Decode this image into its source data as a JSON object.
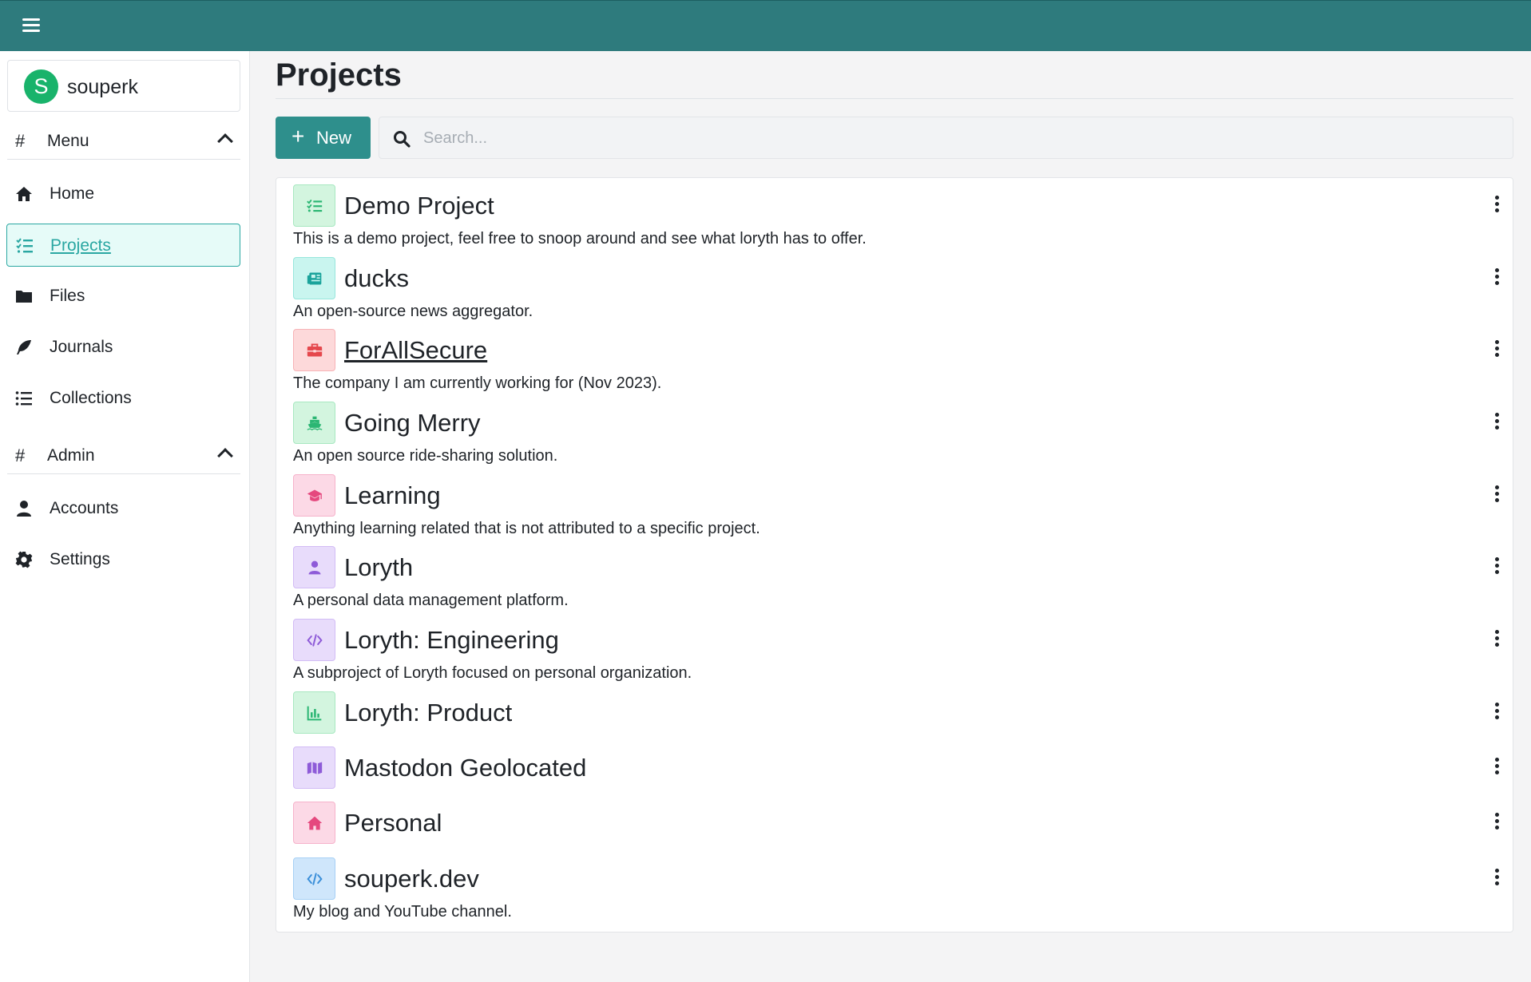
{
  "sidebar": {
    "user": {
      "initial": "S",
      "name": "souperk"
    },
    "sections": [
      {
        "label": "Menu",
        "hash": "#"
      },
      {
        "label": "Admin",
        "hash": "#"
      }
    ],
    "menu_items": [
      {
        "label": "Home",
        "icon": "home-icon"
      },
      {
        "label": "Projects",
        "icon": "checklist-icon",
        "active": true
      },
      {
        "label": "Files",
        "icon": "folder-icon"
      },
      {
        "label": "Journals",
        "icon": "feather-icon"
      },
      {
        "label": "Collections",
        "icon": "list-icon"
      }
    ],
    "admin_items": [
      {
        "label": "Accounts",
        "icon": "user-icon"
      },
      {
        "label": "Settings",
        "icon": "gear-icon"
      }
    ]
  },
  "main": {
    "title": "Projects",
    "new_button": "New",
    "search_placeholder": "Search...",
    "projects": [
      {
        "name": "Demo Project",
        "description": "This is a demo project, feel free to snoop around and see what loryth has to offer.",
        "icon": "checklist-icon",
        "color": "#2bb673"
      },
      {
        "name": "ducks",
        "description": "An open-source news aggregator.",
        "icon": "newspaper-icon",
        "color": "#1aa39b"
      },
      {
        "name": "ForAllSecure",
        "description": "The company I am currently working for (Nov 2023).",
        "icon": "briefcase-icon",
        "color": "#e5484d"
      },
      {
        "name": "Going Merry",
        "description": "An open source ride-sharing solution.",
        "icon": "ship-icon",
        "color": "#2bb673"
      },
      {
        "name": "Learning",
        "description": "Anything learning related that is not attributed to a specific project.",
        "icon": "graduation-cap-icon",
        "color": "#e5487e"
      },
      {
        "name": "Loryth",
        "description": "A personal data management platform.",
        "icon": "user-icon",
        "color": "#8e5bd8"
      },
      {
        "name": "Loryth: Engineering",
        "description": "A subproject of Loryth focused on personal organization.",
        "icon": "code-icon",
        "color": "#8e5bd8"
      },
      {
        "name": "Loryth: Product",
        "description": "",
        "icon": "bar-chart-icon",
        "color": "#2bb673"
      },
      {
        "name": "Mastodon Geolocated",
        "description": "",
        "icon": "map-icon",
        "color": "#8e5bd8"
      },
      {
        "name": "Personal",
        "description": "",
        "icon": "home-icon",
        "color": "#e5487e"
      },
      {
        "name": "souperk.dev",
        "description": "My blog and YouTube channel.",
        "icon": "code-icon",
        "color": "#3b8fd9"
      }
    ]
  }
}
